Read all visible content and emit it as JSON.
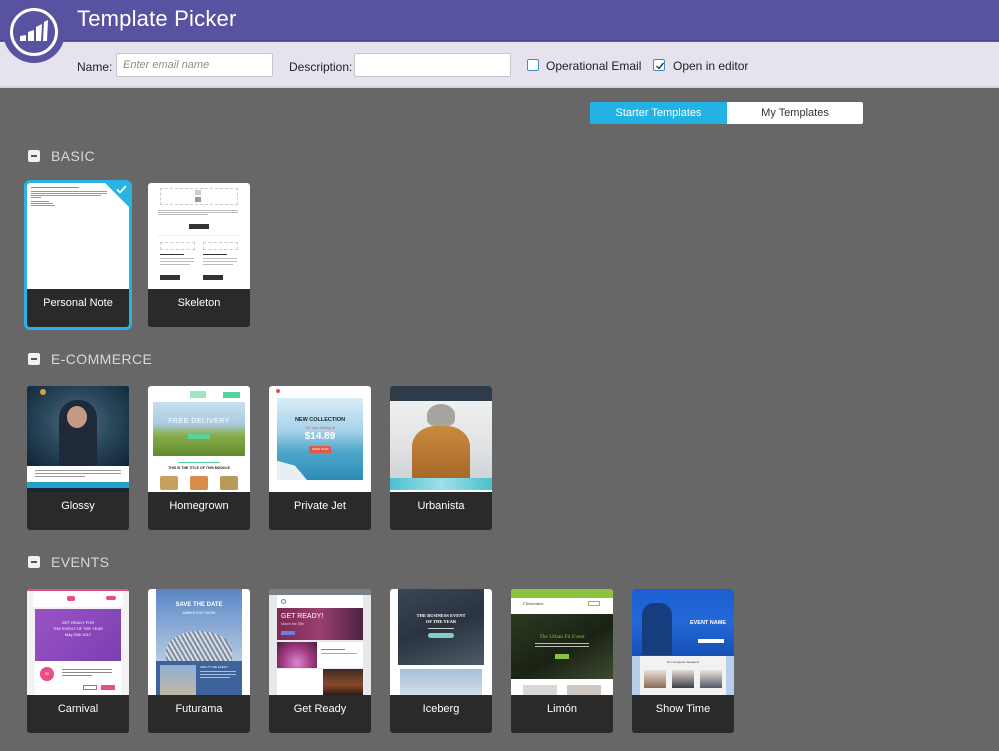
{
  "header": {
    "title": "Template Picker",
    "logo_icon": "marketo-logo-icon"
  },
  "toolbar": {
    "name_label": "Name:",
    "name_placeholder": "Enter email name",
    "name_value": "",
    "description_label": "Description:",
    "description_value": "",
    "operational_email_label": "Operational Email",
    "operational_email_checked": false,
    "open_in_editor_label": "Open in editor",
    "open_in_editor_checked": true
  },
  "tabs": [
    {
      "label": "Starter Templates",
      "active": true
    },
    {
      "label": "My Templates",
      "active": false
    }
  ],
  "sections": [
    {
      "title": "BASIC",
      "templates": [
        {
          "name": "Personal Note",
          "selected": true
        },
        {
          "name": "Skeleton",
          "selected": false
        }
      ]
    },
    {
      "title": "E-COMMERCE",
      "templates": [
        {
          "name": "Glossy",
          "selected": false
        },
        {
          "name": "Homegrown",
          "selected": false,
          "preview_text": [
            "FREE DELIVERY",
            "THIS IS THE TITLE OF THIS MODULE"
          ]
        },
        {
          "name": "Private Jet",
          "selected": false,
          "preview_text": [
            "NEW COLLECTION",
            "Get now starting at",
            "$14.89",
            "SHOP NOW"
          ]
        },
        {
          "name": "Urbanista",
          "selected": false
        }
      ]
    },
    {
      "title": "EVENTS",
      "templates": [
        {
          "name": "Carnival",
          "selected": false,
          "preview_text": [
            "GET READY FOR",
            "THE EVENT OF THE YEAR",
            "May 20th 2017",
            "20"
          ]
        },
        {
          "name": "Futurama",
          "selected": false,
          "preview_text": [
            "SAVE THE DATE",
            "MARKETING SHOW",
            "ABOUT THE EVENT"
          ]
        },
        {
          "name": "Get Ready",
          "selected": false,
          "preview_text": [
            "GET READY!",
            "March the 25th"
          ]
        },
        {
          "name": "Iceberg",
          "selected": false,
          "preview_text": [
            "THE BUSINESS EVENT",
            "OF THE YEAR"
          ]
        },
        {
          "name": "Limón",
          "selected": false,
          "preview_text": [
            "Clementine",
            "The Urban Fit Event"
          ]
        },
        {
          "name": "Show Time",
          "selected": false,
          "preview_text": [
            "EVENT NAME",
            "Our Gorgeous Speakers"
          ]
        }
      ]
    }
  ],
  "colors": {
    "header_bg": "#5753a1",
    "toolbar_bg": "#e6e3ee",
    "page_bg": "#676767",
    "accent": "#22b3e4",
    "card_caption_bg": "#2a2a2a"
  }
}
